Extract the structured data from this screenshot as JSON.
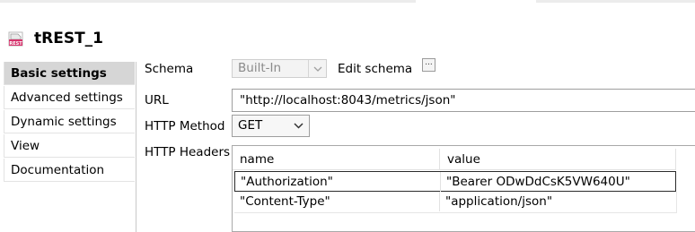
{
  "component": {
    "title": "tREST_1",
    "icon": "rest-component-icon",
    "icon_text": "REST"
  },
  "nav": {
    "items": [
      {
        "label": "Basic settings",
        "active": true
      },
      {
        "label": "Advanced settings",
        "active": false
      },
      {
        "label": "Dynamic settings",
        "active": false
      },
      {
        "label": "View",
        "active": false
      },
      {
        "label": "Documentation",
        "active": false
      }
    ]
  },
  "form": {
    "schema_label": "Schema",
    "schema_value": "Built-In",
    "edit_schema_label": "Edit schema",
    "edit_schema_button": "...",
    "url_label": "URL",
    "url_value": "\"http://localhost:8043/metrics/json\"",
    "method_label": "HTTP Method",
    "method_value": "GET",
    "headers_label": "HTTP Headers"
  },
  "headers_table": {
    "columns": [
      "name",
      "value"
    ],
    "rows": [
      {
        "name": "\"Authorization\"",
        "value": "\"Bearer ODwDdCsK5VW640U\""
      },
      {
        "name": "\"Content-Type\"",
        "value": "\"application/json\""
      }
    ]
  },
  "colors": {
    "active_nav_bg": "#d6d6d6",
    "icon_accent": "#d6336c"
  }
}
